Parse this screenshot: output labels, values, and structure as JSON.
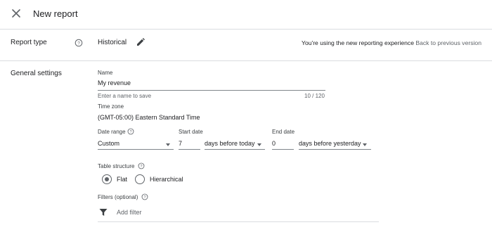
{
  "header": {
    "title": "New report",
    "close_icon": "close-icon"
  },
  "report_type": {
    "label": "Report type",
    "value": "Historical",
    "notice": "You're using the new reporting experience",
    "back_link": "Back to previous version"
  },
  "general_settings": {
    "label": "General settings",
    "name": {
      "label": "Name",
      "value": "My revenue",
      "hint": "Enter a name to save",
      "counter": "10 / 120"
    },
    "time_zone": {
      "label": "Time zone",
      "value": "(GMT-05:00) Eastern Standard Time"
    },
    "date_range": {
      "label": "Date range",
      "value": "Custom"
    },
    "start_date": {
      "label": "Start date",
      "value": "7",
      "unit": "days before today"
    },
    "end_date": {
      "label": "End date",
      "value": "0",
      "unit": "days before yesterday"
    },
    "table_structure": {
      "label": "Table structure",
      "options": [
        "Flat",
        "Hierarchical"
      ],
      "selected": "Flat"
    },
    "filters": {
      "label": "Filters (optional)",
      "add_label": "Add filter"
    }
  }
}
